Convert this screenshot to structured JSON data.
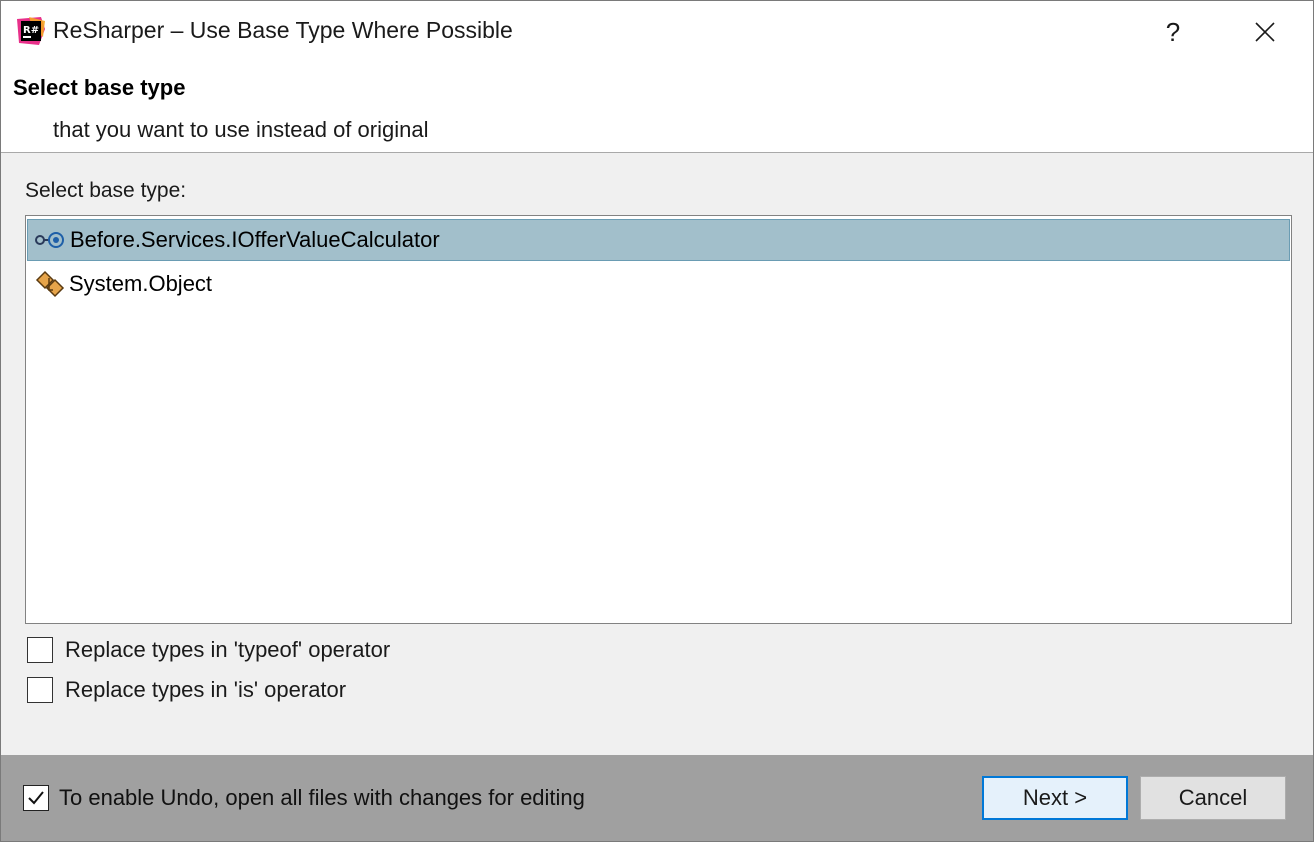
{
  "window": {
    "title": "ReSharper – Use Base Type Where Possible",
    "logo_text": "R#",
    "help_label": "?",
    "close_icon": "close-icon"
  },
  "header": {
    "title": "Select base type",
    "subtitle": "that you want to use instead of original"
  },
  "list": {
    "label": "Select base type:",
    "items": [
      {
        "label": "Before.Services.IOfferValueCalculator",
        "icon": "interface-icon",
        "selected": true
      },
      {
        "label": "System.Object",
        "icon": "class-icon",
        "selected": false
      }
    ]
  },
  "options": [
    {
      "label": "Replace types in 'typeof' operator",
      "checked": false
    },
    {
      "label": "Replace types in 'is' operator",
      "checked": false
    }
  ],
  "footer": {
    "undo_label": "To enable Undo, open all files with changes for editing",
    "undo_checked": true,
    "next_label": "Next >",
    "cancel_label": "Cancel"
  },
  "colors": {
    "selection": "#a2bfcb",
    "footer": "#a0a0a0",
    "focus_border": "#0078d7"
  }
}
